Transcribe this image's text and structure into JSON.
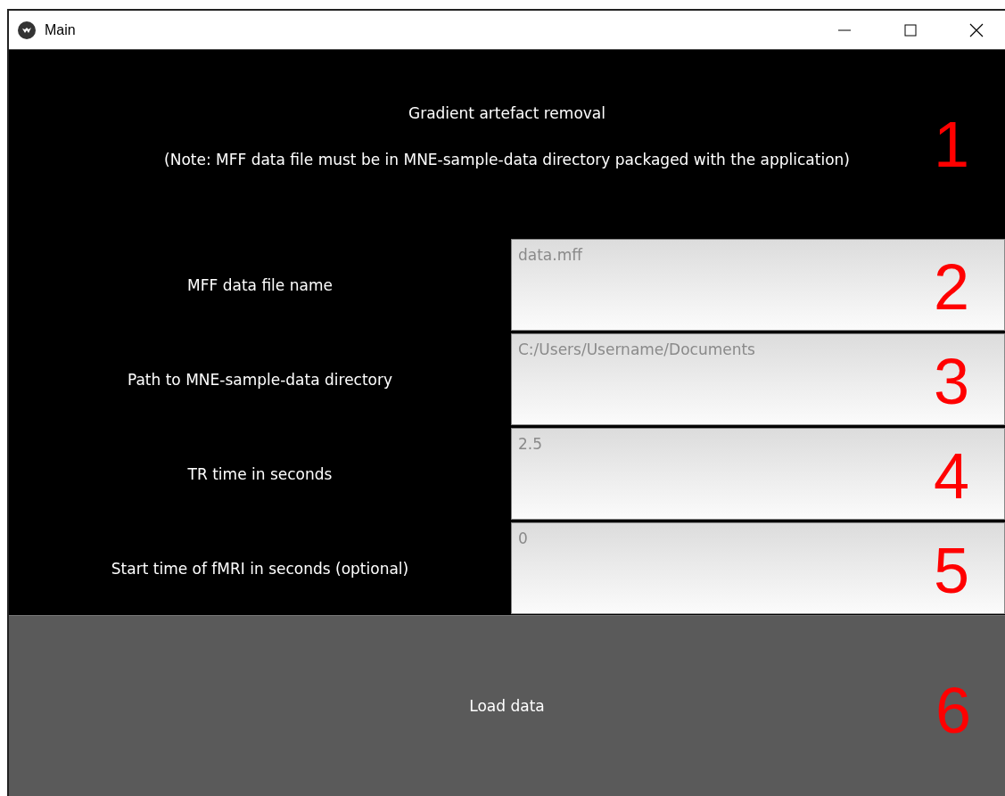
{
  "window": {
    "title": "Main"
  },
  "header": {
    "title": "Gradient artefact removal",
    "note": "(Note: MFF data file must be in MNE-sample-data directory packaged with the application)",
    "marker": "1"
  },
  "fields": [
    {
      "label": "MFF data file name",
      "placeholder": "data.mff",
      "marker": "2"
    },
    {
      "label": "Path to MNE-sample-data directory",
      "placeholder": "C:/Users/Username/Documents",
      "marker": "3"
    },
    {
      "label": "TR time in seconds",
      "placeholder": "2.5",
      "marker": "4"
    },
    {
      "label": "Start time of fMRI in seconds (optional)",
      "placeholder": "0",
      "marker": "5"
    }
  ],
  "button": {
    "label": "Load data",
    "marker": "6"
  }
}
